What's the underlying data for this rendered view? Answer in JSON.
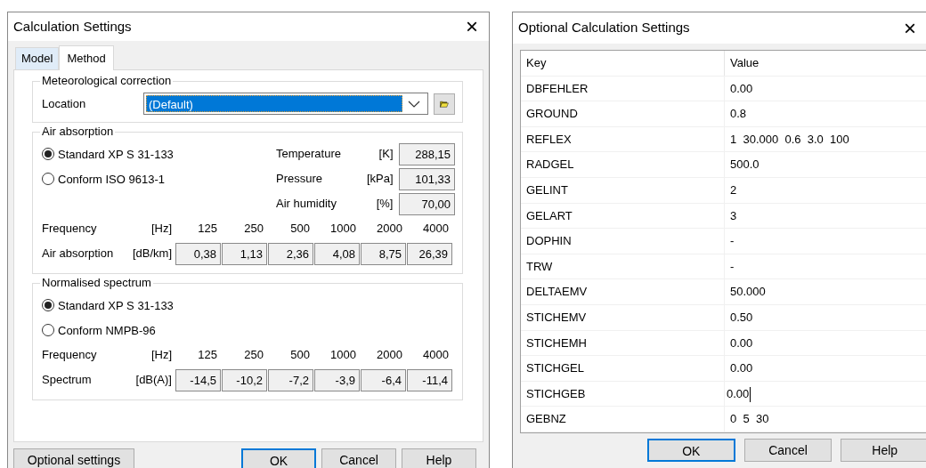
{
  "calc_dialog": {
    "title": "Calculation Settings",
    "close": "×",
    "tabs": [
      {
        "label": "Model",
        "selected": false
      },
      {
        "label": "Method",
        "selected": true
      }
    ],
    "meteo": {
      "title": "Meteorological correction",
      "label": "Location",
      "value": "(Default)",
      "selected": true
    },
    "air": {
      "title": "Air absorption",
      "methods": [
        {
          "label": "Standard XP S 31-133",
          "selected": true
        },
        {
          "label": "Conform ISO 9613-1",
          "selected": false
        }
      ],
      "params": [
        {
          "label": "Temperature",
          "unit": "[K]",
          "value": "288,15"
        },
        {
          "label": "Pressure",
          "unit": "[kPa]",
          "value": "101,33"
        },
        {
          "label": "Air humidity",
          "unit": "[%]",
          "value": "70,00"
        }
      ],
      "freq_label": "Frequency",
      "freq_unit": "[Hz]",
      "frequencies": [
        "125",
        "250",
        "500",
        "1000",
        "2000",
        "4000"
      ],
      "row_label": "Air absorption",
      "row_unit": "[dB/km]",
      "values": [
        "0,38",
        "1,13",
        "2,36",
        "4,08",
        "8,75",
        "26,39"
      ]
    },
    "spectrum": {
      "title": "Normalised spectrum",
      "methods": [
        {
          "label": "Standard XP S 31-133",
          "selected": true
        },
        {
          "label": "Conform NMPB-96",
          "selected": false
        }
      ],
      "freq_label": "Frequency",
      "freq_unit": "[Hz]",
      "frequencies": [
        "125",
        "250",
        "500",
        "1000",
        "2000",
        "4000"
      ],
      "row_label": "Spectrum",
      "row_unit": "[dB(A)]",
      "values": [
        "-14,5",
        "-10,2",
        "-7,2",
        "-3,9",
        "-6,4",
        "-11,4"
      ]
    },
    "buttons": [
      {
        "label": "Optional settings",
        "default": false
      },
      {
        "label": "OK",
        "default": true
      },
      {
        "label": "Cancel",
        "default": false
      },
      {
        "label": "Help",
        "default": false
      }
    ]
  },
  "optional_dialog": {
    "title": "Optional Calculation Settings",
    "close": "×",
    "columns": [
      "Key",
      "Value"
    ],
    "rows": [
      {
        "key": "DBFEHLER",
        "value": "0.00",
        "editing": false
      },
      {
        "key": "GROUND",
        "value": "0.8",
        "editing": false
      },
      {
        "key": "REFLEX",
        "value": "1  30.000  0.6  3.0  100",
        "editing": false
      },
      {
        "key": "RADGEL",
        "value": "500.0",
        "editing": false
      },
      {
        "key": "GELINT",
        "value": "2",
        "editing": false
      },
      {
        "key": "GELART",
        "value": "3",
        "editing": false
      },
      {
        "key": "DOPHIN",
        "value": "-",
        "editing": false
      },
      {
        "key": "TRW",
        "value": "-",
        "editing": false
      },
      {
        "key": "DELTAEMV",
        "value": "50.000",
        "editing": false
      },
      {
        "key": "STICHEMV",
        "value": "0.50",
        "editing": false
      },
      {
        "key": "STICHEMH",
        "value": "0.00",
        "editing": false
      },
      {
        "key": "STICHGEL",
        "value": "0.00",
        "editing": false
      },
      {
        "key": "STICHGEB",
        "value": "0.00",
        "editing": true
      },
      {
        "key": "GEBNZ",
        "value": "0  5  30",
        "editing": false
      }
    ],
    "buttons": [
      {
        "label": "OK",
        "default": true
      },
      {
        "label": "Cancel",
        "default": false
      },
      {
        "label": "Help",
        "default": false
      }
    ]
  }
}
